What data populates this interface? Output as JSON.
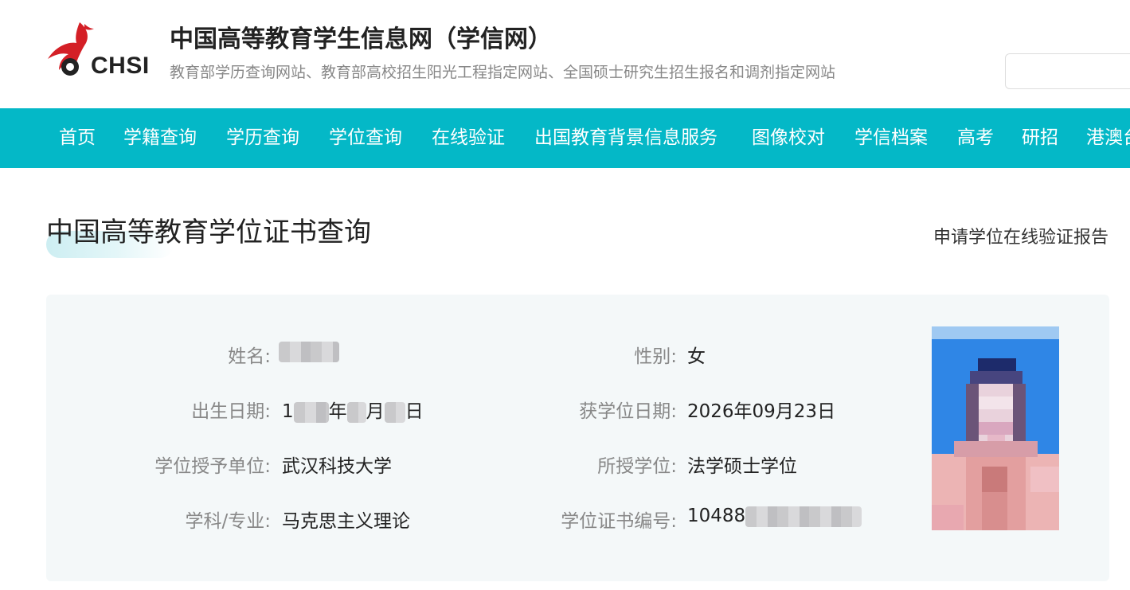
{
  "header": {
    "logo_text": "CHSI",
    "site_title": "中国高等教育学生信息网（学信网）",
    "site_subtitle": "教育部学历查询网站、教育部高校招生阳光工程指定网站、全国硕士研究生招生报名和调剂指定网站",
    "search_value": ""
  },
  "nav": {
    "items": [
      "首页",
      "学籍查询",
      "学历查询",
      "学位查询",
      "在线验证",
      "出国教育背景信息服务",
      "图像校对",
      "学信档案",
      "高考",
      "研招",
      "港澳台"
    ]
  },
  "page": {
    "title": "中国高等教育学位证书查询",
    "report_link": "申请学位在线验证报告"
  },
  "info": {
    "name_label": "姓名:",
    "gender_label": "性别:",
    "gender_value": "女",
    "birth_label": "出生日期:",
    "birth_prefix": "1",
    "birth_year_char": "年",
    "birth_month_char": "月",
    "birth_day_char": "日",
    "degree_date_label": "获学位日期:",
    "degree_date_value": "2026年09月23日",
    "school_label": "学位授予单位:",
    "school_value": "武汉科技大学",
    "degree_label": "所授学位:",
    "degree_value": "法学硕士学位",
    "major_label": "学科/专业:",
    "major_value": "马克思主义理论",
    "cert_label": "学位证书编号:",
    "cert_prefix": "10488"
  },
  "colors": {
    "nav_bg": "#04b8c7",
    "card_bg": "#f4f8f9",
    "logo_red": "#d41f26"
  }
}
